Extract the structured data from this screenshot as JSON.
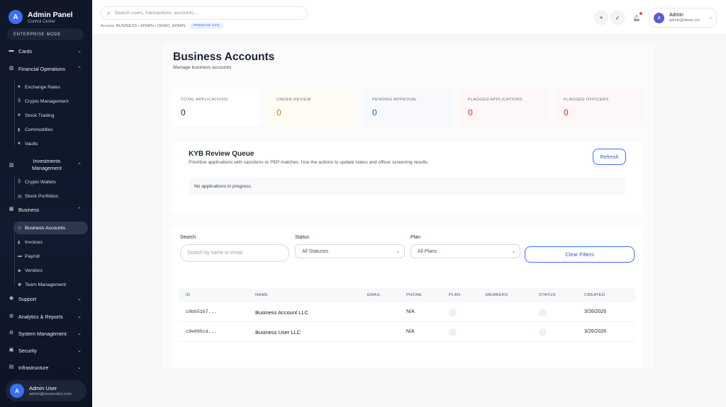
{
  "brand": {
    "logo_letter": "A",
    "title": "Admin Panel",
    "subtitle": "Control Center",
    "mode": "ENTERPRISE MODE"
  },
  "sidebar": {
    "items": [
      {
        "label": "Cards",
        "icon": "card-icon"
      },
      {
        "label": "Financial Operations",
        "icon": "bank-icon"
      },
      {
        "label": "Investments Management",
        "icon": "chart-icon"
      },
      {
        "label": "Business",
        "icon": "briefcase-icon"
      },
      {
        "label": "Support",
        "icon": "headset-icon"
      },
      {
        "label": "Analytics & Reports",
        "icon": "analytics-icon"
      },
      {
        "label": "System Management",
        "icon": "gear-icon"
      },
      {
        "label": "Security",
        "icon": "lock-icon"
      },
      {
        "label": "Infrastructure",
        "icon": "server-icon"
      }
    ],
    "financial_sub": [
      "Exchange Rates",
      "Crypto Management",
      "Stock Trading",
      "Commodities",
      "Vaults"
    ],
    "investments_sub": [
      "Crypto Wallets",
      "Stock Portfolios"
    ],
    "business_sub": [
      "Business Accounts",
      "Invoices",
      "Payroll",
      "Vendors",
      "Team Management"
    ],
    "active": "Business Accounts"
  },
  "user": {
    "initial": "A",
    "name": "Admin User",
    "email": "admin@morevolut.com"
  },
  "topbar": {
    "search_placeholder": "Search users, transactions, accounts...",
    "breadcrumb": "Access: BUSINESS • ADMIN • DEMO_ADMIN",
    "tag": "PREMIUM OPS",
    "admin_initial": "a",
    "admin_name": "Admin",
    "admin_email": "admin@demo.cm"
  },
  "page": {
    "title": "Business Accounts",
    "subtitle": "Manage business accounts"
  },
  "stats": [
    {
      "label": "TOTAL APPLICATIONS",
      "value": "0",
      "color": "#1f2937"
    },
    {
      "label": "UNDER REVIEW",
      "value": "0",
      "color": "#d97706"
    },
    {
      "label": "PENDING APPROVAL",
      "value": "0",
      "color": "#2f5fd0"
    },
    {
      "label": "FLAGGED APPLICATIONS",
      "value": "0",
      "color": "#dc2626"
    },
    {
      "label": "FLAGGED OFFICERS",
      "value": "0",
      "color": "#dc2626"
    }
  ],
  "kyb": {
    "title": "KYB Review Queue",
    "description": "Prioritise applications with sanctions or PEP matches. Use the actions to update status and officer screening results.",
    "refresh": "Refresh",
    "empty": "No applications in progress."
  },
  "filters": {
    "search_label": "Search",
    "search_placeholder": "Search by name or email",
    "status_label": "Status",
    "status_value": "All Statuses",
    "plan_label": "Plan",
    "plan_value": "All Plans",
    "clear": "Clear Filters"
  },
  "table": {
    "headers": [
      "ID",
      "NAME",
      "EMAIL",
      "PHONE",
      "PLAN",
      "MEMBERS",
      "STATUS",
      "CREATED"
    ],
    "rows": [
      {
        "id": "c8bb51b7...",
        "name": "Business Account LLC",
        "email": "",
        "phone": "N/A",
        "members": "",
        "created": "3/26/2026"
      },
      {
        "id": "c9e895cd...",
        "name": "Business User LLC",
        "email": "",
        "phone": "N/A",
        "members": "",
        "created": "3/26/2026"
      }
    ]
  }
}
